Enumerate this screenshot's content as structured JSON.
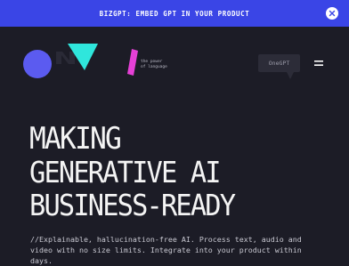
{
  "banner": {
    "text": "BIZGPT: EMBED GPT IN YOUR PRODUCT",
    "close_icon": "close-icon"
  },
  "header": {
    "tagline_line1": "the power",
    "tagline_line2": "of language",
    "cta_label": "OneGPT",
    "menu_icon": "hamburger-menu-icon"
  },
  "colors": {
    "banner": "#3a45e6",
    "background": "#1c1c26",
    "logo_circle": "#5b5bf0",
    "logo_triangle": "#2fe6dc",
    "logo_bar": "#e640d6",
    "cta_bg": "#2c2c38"
  },
  "hero": {
    "line1": "MAKING",
    "line2": "GENERATIVE AI",
    "line3": "BUSINESS-READY"
  },
  "subtext": {
    "text": "//Explainable, hallucination-free AI. Process text, audio and video with no size limits. Integrate into your product within days."
  }
}
